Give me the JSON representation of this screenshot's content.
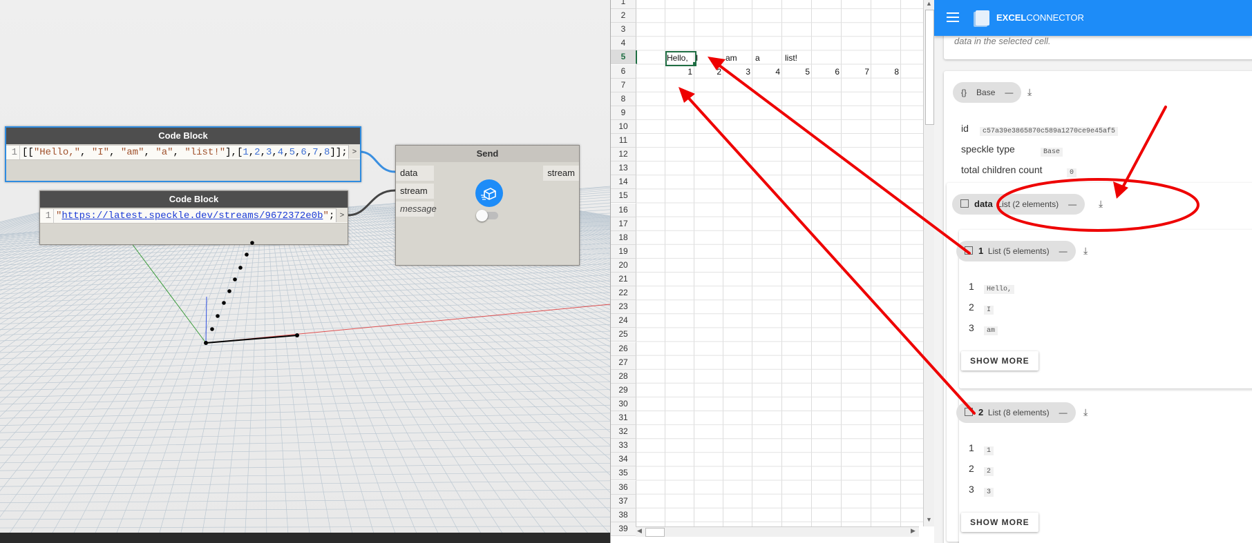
{
  "dynamo": {
    "code_block_1": {
      "title": "Code Block",
      "line_number": "1",
      "out_port": ">"
    },
    "code_block_2": {
      "title": "Code Block",
      "line_number": "1",
      "url": "https://latest.speckle.dev/streams/9672372e0b",
      "out_port": ">"
    },
    "send_node": {
      "title": "Send",
      "inputs": [
        "data",
        "stream",
        "message"
      ],
      "output": "stream"
    }
  },
  "excel": {
    "row_numbers": [
      "1",
      "2",
      "3",
      "4",
      "5",
      "6",
      "7",
      "8",
      "9",
      "10",
      "11",
      "12",
      "13",
      "14",
      "15",
      "16",
      "17",
      "18",
      "19",
      "20",
      "21",
      "22",
      "23",
      "24",
      "25",
      "26",
      "27",
      "28",
      "29",
      "30",
      "31",
      "32",
      "33",
      "34",
      "35",
      "36",
      "37",
      "38",
      "39"
    ],
    "active_row": "5",
    "row5_values": [
      "Hello,",
      "I",
      "am",
      "a",
      "list!"
    ],
    "row6_values": [
      "1",
      "2",
      "3",
      "4",
      "5",
      "6",
      "7",
      "8"
    ]
  },
  "panel": {
    "app_name_bold": "EXCEL",
    "app_name_rest": "CONNECTOR",
    "top_text": "data in the selected cell.",
    "base_chip": {
      "icon": "{}",
      "label": "Base"
    },
    "props": {
      "id_label": "id",
      "id_value": "c57a39e3865870c589a1270ce9e45af5",
      "type_label": "speckle type",
      "type_value": "Base",
      "children_label": "total children count",
      "children_value": "0"
    },
    "data_chip": {
      "name": "data",
      "desc": "List (2 elements)"
    },
    "list1": {
      "index": "1",
      "desc": "List (5 elements)",
      "items": [
        {
          "i": "1",
          "v": "Hello,"
        },
        {
          "i": "2",
          "v": "I"
        },
        {
          "i": "3",
          "v": "am"
        }
      ],
      "button": "SHOW MORE"
    },
    "list2": {
      "index": "2",
      "desc": "List (8 elements)",
      "items": [
        {
          "i": "1",
          "v": "1"
        },
        {
          "i": "2",
          "v": "2"
        },
        {
          "i": "3",
          "v": "3"
        }
      ],
      "button": "SHOW MORE"
    }
  },
  "colors": {
    "accent_blue": "#1d8cf8",
    "annotation_red": "#ee0000",
    "selected_node_border": "#2f8ce0"
  }
}
